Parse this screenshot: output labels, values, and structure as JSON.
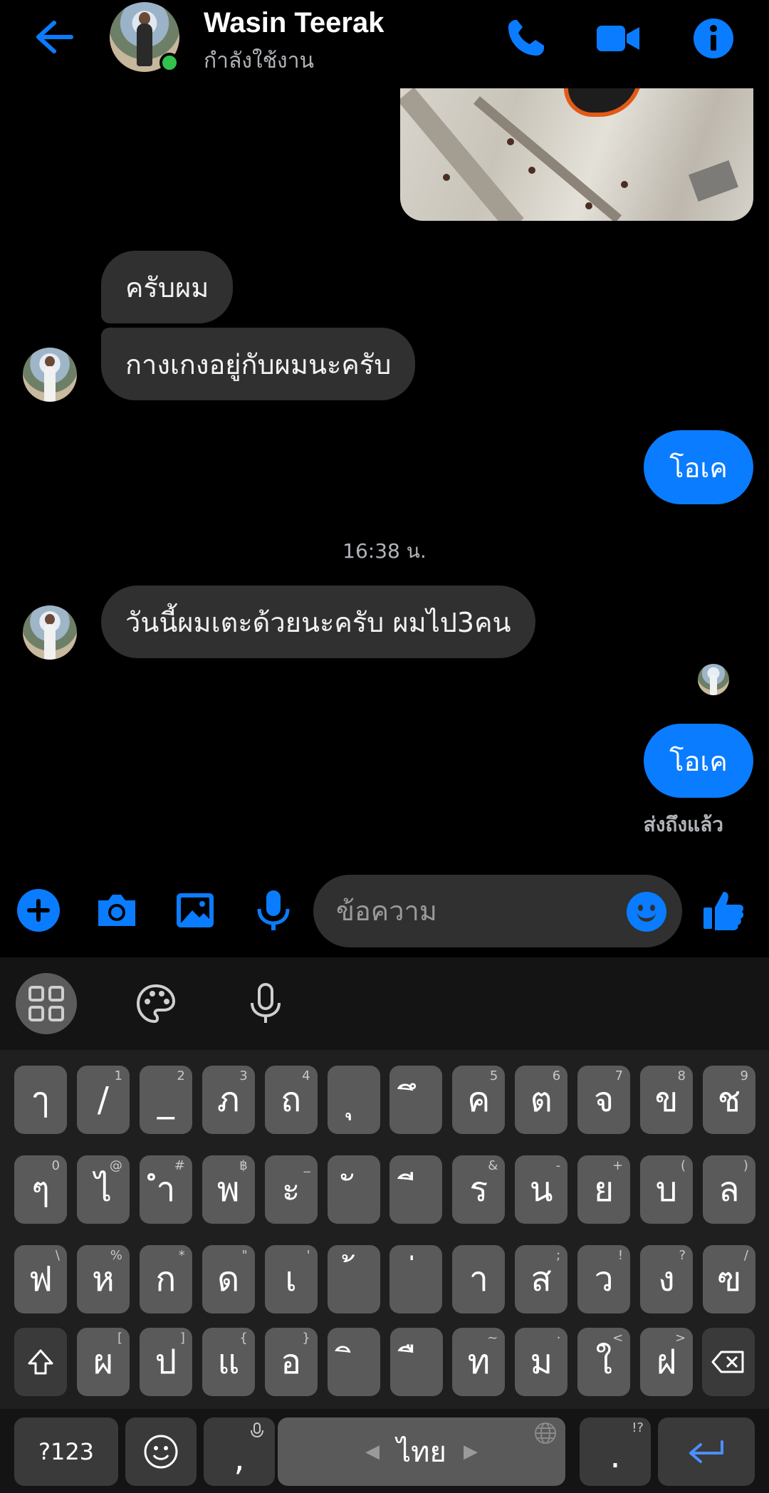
{
  "header": {
    "contact_name": "Wasin Teerak",
    "status": "กำลังใช้งาน"
  },
  "messages": {
    "in_1": "ครับผม",
    "in_2": "กางเกงอยู่กับผมนะครับ",
    "out_1": "โอเค",
    "timestamp": "16:38 น.",
    "in_3": "วันนี้ผมเตะด้วยนะครับ ผมไป3คน",
    "out_2": "โอเค",
    "delivered": "ส่งถึงแล้ว"
  },
  "composer": {
    "placeholder": "ข้อความ"
  },
  "keyboard": {
    "row1": [
      {
        "k": "ๅ",
        "h": ""
      },
      {
        "k": "/",
        "h": "1"
      },
      {
        "k": "_",
        "h": "2"
      },
      {
        "k": "ภ",
        "h": "3"
      },
      {
        "k": "ถ",
        "h": "4"
      },
      {
        "k": "ุ",
        "h": ""
      },
      {
        "k": "ึ",
        "h": ""
      },
      {
        "k": "ค",
        "h": "5"
      },
      {
        "k": "ต",
        "h": "6"
      },
      {
        "k": "จ",
        "h": "7"
      },
      {
        "k": "ข",
        "h": "8"
      },
      {
        "k": "ช",
        "h": "9"
      }
    ],
    "row2": [
      {
        "k": "ๆ",
        "h": "0"
      },
      {
        "k": "ไ",
        "h": "@"
      },
      {
        "k": "ำ",
        "h": "#"
      },
      {
        "k": "พ",
        "h": "฿"
      },
      {
        "k": "ะ",
        "h": "_"
      },
      {
        "k": "ั",
        "h": ""
      },
      {
        "k": "ี",
        "h": ""
      },
      {
        "k": "ร",
        "h": "&"
      },
      {
        "k": "น",
        "h": "-"
      },
      {
        "k": "ย",
        "h": "+"
      },
      {
        "k": "บ",
        "h": "("
      },
      {
        "k": "ล",
        "h": ")"
      }
    ],
    "row3": [
      {
        "k": "ฟ",
        "h": "\\"
      },
      {
        "k": "ห",
        "h": "%"
      },
      {
        "k": "ก",
        "h": "*"
      },
      {
        "k": "ด",
        "h": "\""
      },
      {
        "k": "เ",
        "h": "'"
      },
      {
        "k": "้",
        "h": ""
      },
      {
        "k": "่",
        "h": ""
      },
      {
        "k": "า",
        "h": ""
      },
      {
        "k": "ส",
        "h": ";"
      },
      {
        "k": "ว",
        "h": "!"
      },
      {
        "k": "ง",
        "h": "?"
      },
      {
        "k": "ฃ",
        "h": "/"
      }
    ],
    "row4": [
      {
        "k": "ผ",
        "h": "["
      },
      {
        "k": "ป",
        "h": "]"
      },
      {
        "k": "แ",
        "h": "{"
      },
      {
        "k": "อ",
        "h": "}"
      },
      {
        "k": "ิ",
        "h": ""
      },
      {
        "k": "ื",
        "h": ""
      },
      {
        "k": "ท",
        "h": "~"
      },
      {
        "k": "ม",
        "h": "·"
      },
      {
        "k": "ใ",
        "h": "<"
      },
      {
        "k": "ฝ",
        "h": ">"
      }
    ],
    "symbols_label": "?123",
    "comma": ",",
    "space_label": "ไทย",
    "period": ".",
    "period_hint": "!?"
  },
  "colors": {
    "accent": "#0a7cff",
    "online": "#32c24d",
    "incoming_bubble": "#303030",
    "background": "#000000"
  }
}
